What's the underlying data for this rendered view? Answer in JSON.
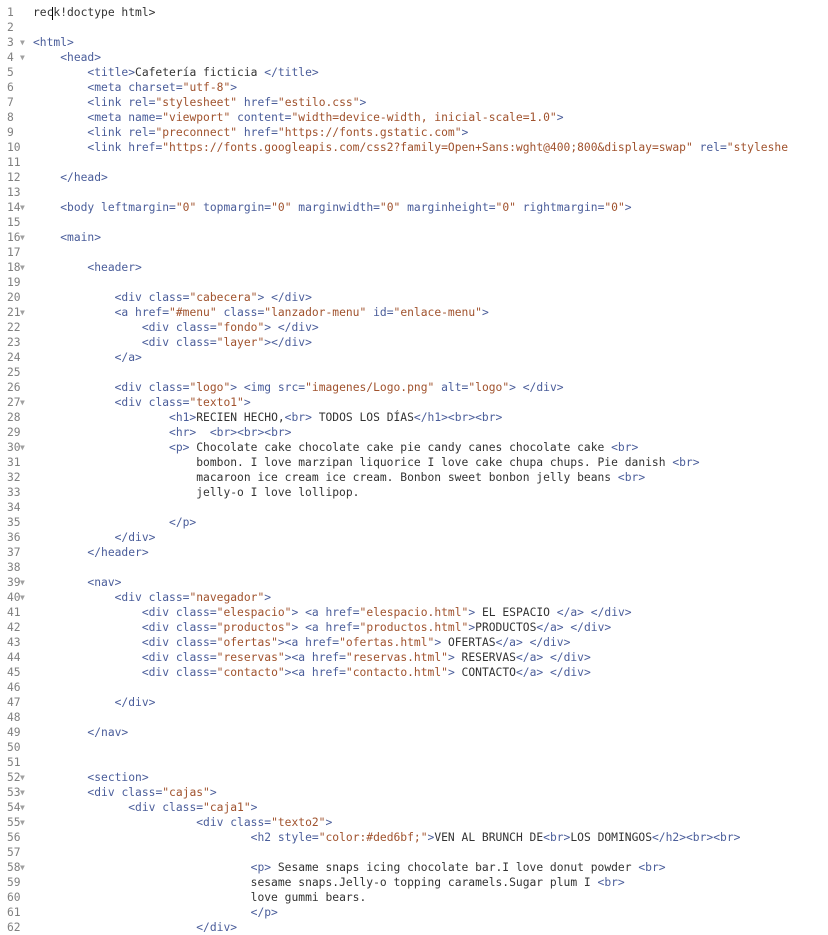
{
  "colors": {
    "tag": "#4a5d9a",
    "attribute": "#4a5d9a",
    "value": "#a0522d",
    "text": "#333333",
    "gutter": "#808080"
  },
  "fold_icon": "triangle-down-icon",
  "lines": [
    {
      "n": "1",
      "fold": false,
      "indent": 0,
      "tokens": [
        {
          "t": "text",
          "v": "rec"
        },
        {
          "t": "cursor",
          "v": ""
        },
        {
          "t": "text",
          "v": "k!doctype html>"
        }
      ]
    },
    {
      "n": "2",
      "fold": false,
      "indent": 0,
      "tokens": []
    },
    {
      "n": "3",
      "fold": true,
      "indent": 0,
      "tokens": [
        {
          "t": "tag",
          "v": "<html>"
        }
      ]
    },
    {
      "n": "4",
      "fold": true,
      "indent": 4,
      "tokens": [
        {
          "t": "tag",
          "v": "<head>"
        }
      ]
    },
    {
      "n": "5",
      "fold": false,
      "indent": 8,
      "tokens": [
        {
          "t": "tag",
          "v": "<title>"
        },
        {
          "t": "text",
          "v": "Cafetería ficticia "
        },
        {
          "t": "tag",
          "v": "</title>"
        }
      ]
    },
    {
      "n": "6",
      "fold": false,
      "indent": 8,
      "tokens": [
        {
          "t": "tag",
          "v": "<meta "
        },
        {
          "t": "attr",
          "v": "charset="
        },
        {
          "t": "val",
          "v": "\"utf-8\""
        },
        {
          "t": "tag",
          "v": ">"
        }
      ]
    },
    {
      "n": "7",
      "fold": false,
      "indent": 8,
      "tokens": [
        {
          "t": "tag",
          "v": "<link "
        },
        {
          "t": "attr",
          "v": "rel="
        },
        {
          "t": "val",
          "v": "\"stylesheet\""
        },
        {
          "t": "attr",
          "v": " href="
        },
        {
          "t": "val",
          "v": "\"estilo.css\""
        },
        {
          "t": "tag",
          "v": ">"
        }
      ]
    },
    {
      "n": "8",
      "fold": false,
      "indent": 8,
      "tokens": [
        {
          "t": "tag",
          "v": "<meta "
        },
        {
          "t": "attr",
          "v": "name="
        },
        {
          "t": "val",
          "v": "\"viewport\""
        },
        {
          "t": "attr",
          "v": " content="
        },
        {
          "t": "val",
          "v": "\"width=device-width, inicial-scale=1.0\""
        },
        {
          "t": "tag",
          "v": ">"
        }
      ]
    },
    {
      "n": "9",
      "fold": false,
      "indent": 8,
      "tokens": [
        {
          "t": "tag",
          "v": "<link "
        },
        {
          "t": "attr",
          "v": "rel="
        },
        {
          "t": "val",
          "v": "\"preconnect\""
        },
        {
          "t": "attr",
          "v": " href="
        },
        {
          "t": "val",
          "v": "\"https://fonts.gstatic.com\""
        },
        {
          "t": "tag",
          "v": ">"
        }
      ]
    },
    {
      "n": "10",
      "fold": false,
      "indent": 8,
      "tokens": [
        {
          "t": "tag",
          "v": "<link "
        },
        {
          "t": "attr",
          "v": "href="
        },
        {
          "t": "val",
          "v": "\"https://fonts.googleapis.com/css2?family=Open+Sans:wght@400;800&display=swap\""
        },
        {
          "t": "attr",
          "v": " rel="
        },
        {
          "t": "val",
          "v": "\"styleshe"
        }
      ]
    },
    {
      "n": "11",
      "fold": false,
      "indent": 0,
      "tokens": []
    },
    {
      "n": "12",
      "fold": false,
      "indent": 4,
      "tokens": [
        {
          "t": "tag",
          "v": "</head>"
        }
      ]
    },
    {
      "n": "13",
      "fold": false,
      "indent": 0,
      "tokens": []
    },
    {
      "n": "14",
      "fold": true,
      "indent": 4,
      "tokens": [
        {
          "t": "tag",
          "v": "<body "
        },
        {
          "t": "attr",
          "v": "leftmargin="
        },
        {
          "t": "val",
          "v": "\"0\""
        },
        {
          "t": "attr",
          "v": " topmargin="
        },
        {
          "t": "val",
          "v": "\"0\""
        },
        {
          "t": "attr",
          "v": " marginwidth="
        },
        {
          "t": "val",
          "v": "\"0\""
        },
        {
          "t": "attr",
          "v": " marginheight="
        },
        {
          "t": "val",
          "v": "\"0\""
        },
        {
          "t": "attr",
          "v": " rightmargin="
        },
        {
          "t": "val",
          "v": "\"0\""
        },
        {
          "t": "tag",
          "v": ">"
        }
      ]
    },
    {
      "n": "15",
      "fold": false,
      "indent": 0,
      "tokens": []
    },
    {
      "n": "16",
      "fold": true,
      "indent": 4,
      "tokens": [
        {
          "t": "tag",
          "v": "<main>"
        }
      ]
    },
    {
      "n": "17",
      "fold": false,
      "indent": 0,
      "tokens": []
    },
    {
      "n": "18",
      "fold": true,
      "indent": 8,
      "tokens": [
        {
          "t": "tag",
          "v": "<header>"
        }
      ]
    },
    {
      "n": "19",
      "fold": false,
      "indent": 0,
      "tokens": []
    },
    {
      "n": "20",
      "fold": false,
      "indent": 12,
      "tokens": [
        {
          "t": "tag",
          "v": "<div "
        },
        {
          "t": "attr",
          "v": "class="
        },
        {
          "t": "val",
          "v": "\"cabecera\""
        },
        {
          "t": "tag",
          "v": "> </div>"
        }
      ]
    },
    {
      "n": "21",
      "fold": true,
      "indent": 12,
      "tokens": [
        {
          "t": "tag",
          "v": "<a "
        },
        {
          "t": "attr",
          "v": "href="
        },
        {
          "t": "val",
          "v": "\"#menu\""
        },
        {
          "t": "attr",
          "v": " class="
        },
        {
          "t": "val",
          "v": "\"lanzador-menu\""
        },
        {
          "t": "attr",
          "v": " id="
        },
        {
          "t": "val",
          "v": "\"enlace-menu\""
        },
        {
          "t": "tag",
          "v": ">"
        }
      ]
    },
    {
      "n": "22",
      "fold": false,
      "indent": 16,
      "tokens": [
        {
          "t": "tag",
          "v": "<div "
        },
        {
          "t": "attr",
          "v": "class="
        },
        {
          "t": "val",
          "v": "\"fondo\""
        },
        {
          "t": "tag",
          "v": "> </div>"
        }
      ]
    },
    {
      "n": "23",
      "fold": false,
      "indent": 16,
      "tokens": [
        {
          "t": "tag",
          "v": "<div "
        },
        {
          "t": "attr",
          "v": "class="
        },
        {
          "t": "val",
          "v": "\"layer\""
        },
        {
          "t": "tag",
          "v": "></div>"
        }
      ]
    },
    {
      "n": "24",
      "fold": false,
      "indent": 12,
      "tokens": [
        {
          "t": "tag",
          "v": "</a>"
        }
      ]
    },
    {
      "n": "25",
      "fold": false,
      "indent": 0,
      "tokens": []
    },
    {
      "n": "26",
      "fold": false,
      "indent": 12,
      "tokens": [
        {
          "t": "tag",
          "v": "<div "
        },
        {
          "t": "attr",
          "v": "class="
        },
        {
          "t": "val",
          "v": "\"logo\""
        },
        {
          "t": "tag",
          "v": "> <img "
        },
        {
          "t": "attr",
          "v": "src="
        },
        {
          "t": "val",
          "v": "\"imagenes/Logo.png\""
        },
        {
          "t": "attr",
          "v": " alt="
        },
        {
          "t": "val",
          "v": "\"logo\""
        },
        {
          "t": "tag",
          "v": "> </div>"
        }
      ]
    },
    {
      "n": "27",
      "fold": true,
      "indent": 12,
      "tokens": [
        {
          "t": "tag",
          "v": "<div "
        },
        {
          "t": "attr",
          "v": "class="
        },
        {
          "t": "val",
          "v": "\"texto1\""
        },
        {
          "t": "tag",
          "v": ">"
        }
      ]
    },
    {
      "n": "28",
      "fold": false,
      "indent": 20,
      "tokens": [
        {
          "t": "tag",
          "v": "<h1>"
        },
        {
          "t": "text",
          "v": "RECIEN HECHO,"
        },
        {
          "t": "tag",
          "v": "<br>"
        },
        {
          "t": "text",
          "v": " TODOS LOS DÍAS"
        },
        {
          "t": "tag",
          "v": "</h1><br><br>"
        }
      ]
    },
    {
      "n": "29",
      "fold": false,
      "indent": 20,
      "tokens": [
        {
          "t": "tag",
          "v": "<hr>"
        },
        {
          "t": "text",
          "v": "  "
        },
        {
          "t": "tag",
          "v": "<br><br><br>"
        }
      ]
    },
    {
      "n": "30",
      "fold": true,
      "indent": 20,
      "tokens": [
        {
          "t": "tag",
          "v": "<p>"
        },
        {
          "t": "text",
          "v": " Chocolate cake chocolate cake pie candy canes chocolate cake "
        },
        {
          "t": "tag",
          "v": "<br>"
        }
      ]
    },
    {
      "n": "31",
      "fold": false,
      "indent": 24,
      "tokens": [
        {
          "t": "text",
          "v": "bombon. I love marzipan liquorice I love cake chupa chups. Pie danish "
        },
        {
          "t": "tag",
          "v": "<br>"
        }
      ]
    },
    {
      "n": "32",
      "fold": false,
      "indent": 24,
      "tokens": [
        {
          "t": "text",
          "v": "macaroon ice cream ice cream. Bonbon sweet bonbon jelly beans "
        },
        {
          "t": "tag",
          "v": "<br>"
        }
      ]
    },
    {
      "n": "33",
      "fold": false,
      "indent": 24,
      "tokens": [
        {
          "t": "text",
          "v": "jelly-o I love lollipop."
        }
      ]
    },
    {
      "n": "34",
      "fold": false,
      "indent": 0,
      "tokens": []
    },
    {
      "n": "35",
      "fold": false,
      "indent": 20,
      "tokens": [
        {
          "t": "tag",
          "v": "</p>"
        }
      ]
    },
    {
      "n": "36",
      "fold": false,
      "indent": 12,
      "tokens": [
        {
          "t": "tag",
          "v": "</div>"
        }
      ]
    },
    {
      "n": "37",
      "fold": false,
      "indent": 8,
      "tokens": [
        {
          "t": "tag",
          "v": "</header>"
        }
      ]
    },
    {
      "n": "38",
      "fold": false,
      "indent": 0,
      "tokens": []
    },
    {
      "n": "39",
      "fold": true,
      "indent": 8,
      "tokens": [
        {
          "t": "tag",
          "v": "<nav>"
        }
      ]
    },
    {
      "n": "40",
      "fold": true,
      "indent": 12,
      "tokens": [
        {
          "t": "tag",
          "v": "<div "
        },
        {
          "t": "attr",
          "v": "class="
        },
        {
          "t": "val",
          "v": "\"navegador\""
        },
        {
          "t": "tag",
          "v": ">"
        }
      ]
    },
    {
      "n": "41",
      "fold": false,
      "indent": 16,
      "tokens": [
        {
          "t": "tag",
          "v": "<div "
        },
        {
          "t": "attr",
          "v": "class="
        },
        {
          "t": "val",
          "v": "\"elespacio\""
        },
        {
          "t": "tag",
          "v": "> <a "
        },
        {
          "t": "attr",
          "v": "href="
        },
        {
          "t": "val",
          "v": "\"elespacio.html\""
        },
        {
          "t": "tag",
          "v": ">"
        },
        {
          "t": "text",
          "v": " EL ESPACIO "
        },
        {
          "t": "tag",
          "v": "</a> </div>"
        }
      ]
    },
    {
      "n": "42",
      "fold": false,
      "indent": 16,
      "tokens": [
        {
          "t": "tag",
          "v": "<div "
        },
        {
          "t": "attr",
          "v": "class="
        },
        {
          "t": "val",
          "v": "\"productos\""
        },
        {
          "t": "tag",
          "v": "> <a "
        },
        {
          "t": "attr",
          "v": "href="
        },
        {
          "t": "val",
          "v": "\"productos.html\""
        },
        {
          "t": "tag",
          "v": ">"
        },
        {
          "t": "text",
          "v": "PRODUCTOS"
        },
        {
          "t": "tag",
          "v": "</a> </div>"
        }
      ]
    },
    {
      "n": "43",
      "fold": false,
      "indent": 16,
      "tokens": [
        {
          "t": "tag",
          "v": "<div "
        },
        {
          "t": "attr",
          "v": "class="
        },
        {
          "t": "val",
          "v": "\"ofertas\""
        },
        {
          "t": "tag",
          "v": "><a "
        },
        {
          "t": "attr",
          "v": "href="
        },
        {
          "t": "val",
          "v": "\"ofertas.html\""
        },
        {
          "t": "tag",
          "v": ">"
        },
        {
          "t": "text",
          "v": " OFERTAS"
        },
        {
          "t": "tag",
          "v": "</a> </div>"
        }
      ]
    },
    {
      "n": "44",
      "fold": false,
      "indent": 16,
      "tokens": [
        {
          "t": "tag",
          "v": "<div "
        },
        {
          "t": "attr",
          "v": "class="
        },
        {
          "t": "val",
          "v": "\"reservas\""
        },
        {
          "t": "tag",
          "v": "><a "
        },
        {
          "t": "attr",
          "v": "href="
        },
        {
          "t": "val",
          "v": "\"reservas.html\""
        },
        {
          "t": "tag",
          "v": ">"
        },
        {
          "t": "text",
          "v": " RESERVAS"
        },
        {
          "t": "tag",
          "v": "</a> </div>"
        }
      ]
    },
    {
      "n": "45",
      "fold": false,
      "indent": 16,
      "tokens": [
        {
          "t": "tag",
          "v": "<div "
        },
        {
          "t": "attr",
          "v": "class="
        },
        {
          "t": "val",
          "v": "\"contacto\""
        },
        {
          "t": "tag",
          "v": "><a "
        },
        {
          "t": "attr",
          "v": "href="
        },
        {
          "t": "val",
          "v": "\"contacto.html\""
        },
        {
          "t": "tag",
          "v": ">"
        },
        {
          "t": "text",
          "v": " CONTACTO"
        },
        {
          "t": "tag",
          "v": "</a> </div>"
        }
      ]
    },
    {
      "n": "46",
      "fold": false,
      "indent": 0,
      "tokens": []
    },
    {
      "n": "47",
      "fold": false,
      "indent": 12,
      "tokens": [
        {
          "t": "tag",
          "v": "</div>"
        }
      ]
    },
    {
      "n": "48",
      "fold": false,
      "indent": 0,
      "tokens": []
    },
    {
      "n": "49",
      "fold": false,
      "indent": 8,
      "tokens": [
        {
          "t": "tag",
          "v": "</nav>"
        }
      ]
    },
    {
      "n": "50",
      "fold": false,
      "indent": 0,
      "tokens": []
    },
    {
      "n": "51",
      "fold": false,
      "indent": 0,
      "tokens": []
    },
    {
      "n": "52",
      "fold": true,
      "indent": 8,
      "tokens": [
        {
          "t": "tag",
          "v": "<section>"
        }
      ]
    },
    {
      "n": "53",
      "fold": true,
      "indent": 8,
      "tokens": [
        {
          "t": "tag",
          "v": "<div "
        },
        {
          "t": "attr",
          "v": "class="
        },
        {
          "t": "val",
          "v": "\"cajas\""
        },
        {
          "t": "tag",
          "v": ">"
        }
      ]
    },
    {
      "n": "54",
      "fold": true,
      "indent": 14,
      "tokens": [
        {
          "t": "tag",
          "v": "<div "
        },
        {
          "t": "attr",
          "v": "class="
        },
        {
          "t": "val",
          "v": "\"caja1\""
        },
        {
          "t": "tag",
          "v": ">"
        }
      ]
    },
    {
      "n": "55",
      "fold": true,
      "indent": 24,
      "tokens": [
        {
          "t": "tag",
          "v": "<div "
        },
        {
          "t": "attr",
          "v": "class="
        },
        {
          "t": "val",
          "v": "\"texto2\""
        },
        {
          "t": "tag",
          "v": ">"
        }
      ]
    },
    {
      "n": "56",
      "fold": false,
      "indent": 32,
      "tokens": [
        {
          "t": "tag",
          "v": "<h2 "
        },
        {
          "t": "attr",
          "v": "style="
        },
        {
          "t": "val",
          "v": "\"color:#ded6bf;\""
        },
        {
          "t": "tag",
          "v": ">"
        },
        {
          "t": "text",
          "v": "VEN AL BRUNCH DE"
        },
        {
          "t": "tag",
          "v": "<br>"
        },
        {
          "t": "text",
          "v": "LOS DOMINGOS"
        },
        {
          "t": "tag",
          "v": "</h2><br><br>"
        }
      ]
    },
    {
      "n": "57",
      "fold": false,
      "indent": 0,
      "tokens": []
    },
    {
      "n": "58",
      "fold": true,
      "indent": 32,
      "tokens": [
        {
          "t": "tag",
          "v": "<p>"
        },
        {
          "t": "text",
          "v": " Sesame snaps icing chocolate bar.I love donut powder "
        },
        {
          "t": "tag",
          "v": "<br>"
        }
      ]
    },
    {
      "n": "59",
      "fold": false,
      "indent": 32,
      "tokens": [
        {
          "t": "text",
          "v": "sesame snaps.Jelly-o topping caramels.Sugar plum I "
        },
        {
          "t": "tag",
          "v": "<br>"
        }
      ]
    },
    {
      "n": "60",
      "fold": false,
      "indent": 32,
      "tokens": [
        {
          "t": "text",
          "v": "love gummi bears."
        }
      ]
    },
    {
      "n": "61",
      "fold": false,
      "indent": 32,
      "tokens": [
        {
          "t": "tag",
          "v": "</p>"
        }
      ]
    },
    {
      "n": "62",
      "fold": false,
      "indent": 24,
      "tokens": [
        {
          "t": "tag",
          "v": "</div>"
        }
      ]
    }
  ]
}
